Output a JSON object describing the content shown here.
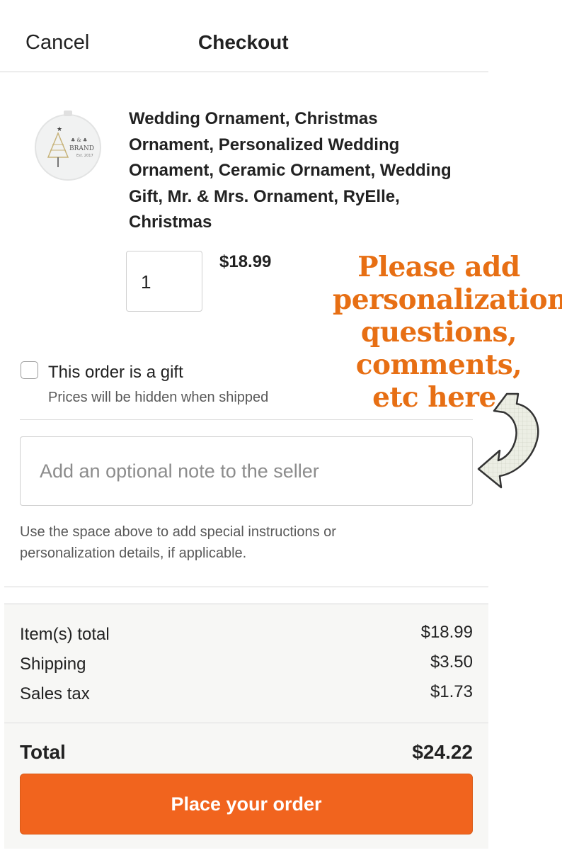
{
  "header": {
    "cancel_label": "Cancel",
    "title": "Checkout"
  },
  "item": {
    "title": "Wedding Ornament, Christmas Ornament, Personalized Wedding Ornament, Ceramic Ornament, Wedding Gift, Mr. & Mrs. Ornament, RyElle, Christmas",
    "thumbnail_text": "BRAND",
    "quantity": "1",
    "price": "$18.99"
  },
  "annotation": {
    "lines": [
      "Please add",
      "personalization,",
      "questions,",
      "comments,",
      "etc here."
    ],
    "color": "#e76f14",
    "arrow_icon": "curved-arrow-left-icon"
  },
  "gift": {
    "label": "This order is a gift",
    "sublabel": "Prices will be hidden when shipped",
    "checked": false
  },
  "note": {
    "placeholder": "Add an optional note to the seller",
    "value": "",
    "help_text": "Use the space above to add special instructions or personalization details, if applicable."
  },
  "summary": {
    "rows": [
      {
        "label": "Item(s) total",
        "value": "$18.99"
      },
      {
        "label": "Shipping",
        "value": "$3.50"
      },
      {
        "label": "Sales tax",
        "value": "$1.73"
      }
    ],
    "total_label": "Total",
    "total_value": "$24.22"
  },
  "cta": {
    "label": "Place your order",
    "color": "#f1641e"
  }
}
